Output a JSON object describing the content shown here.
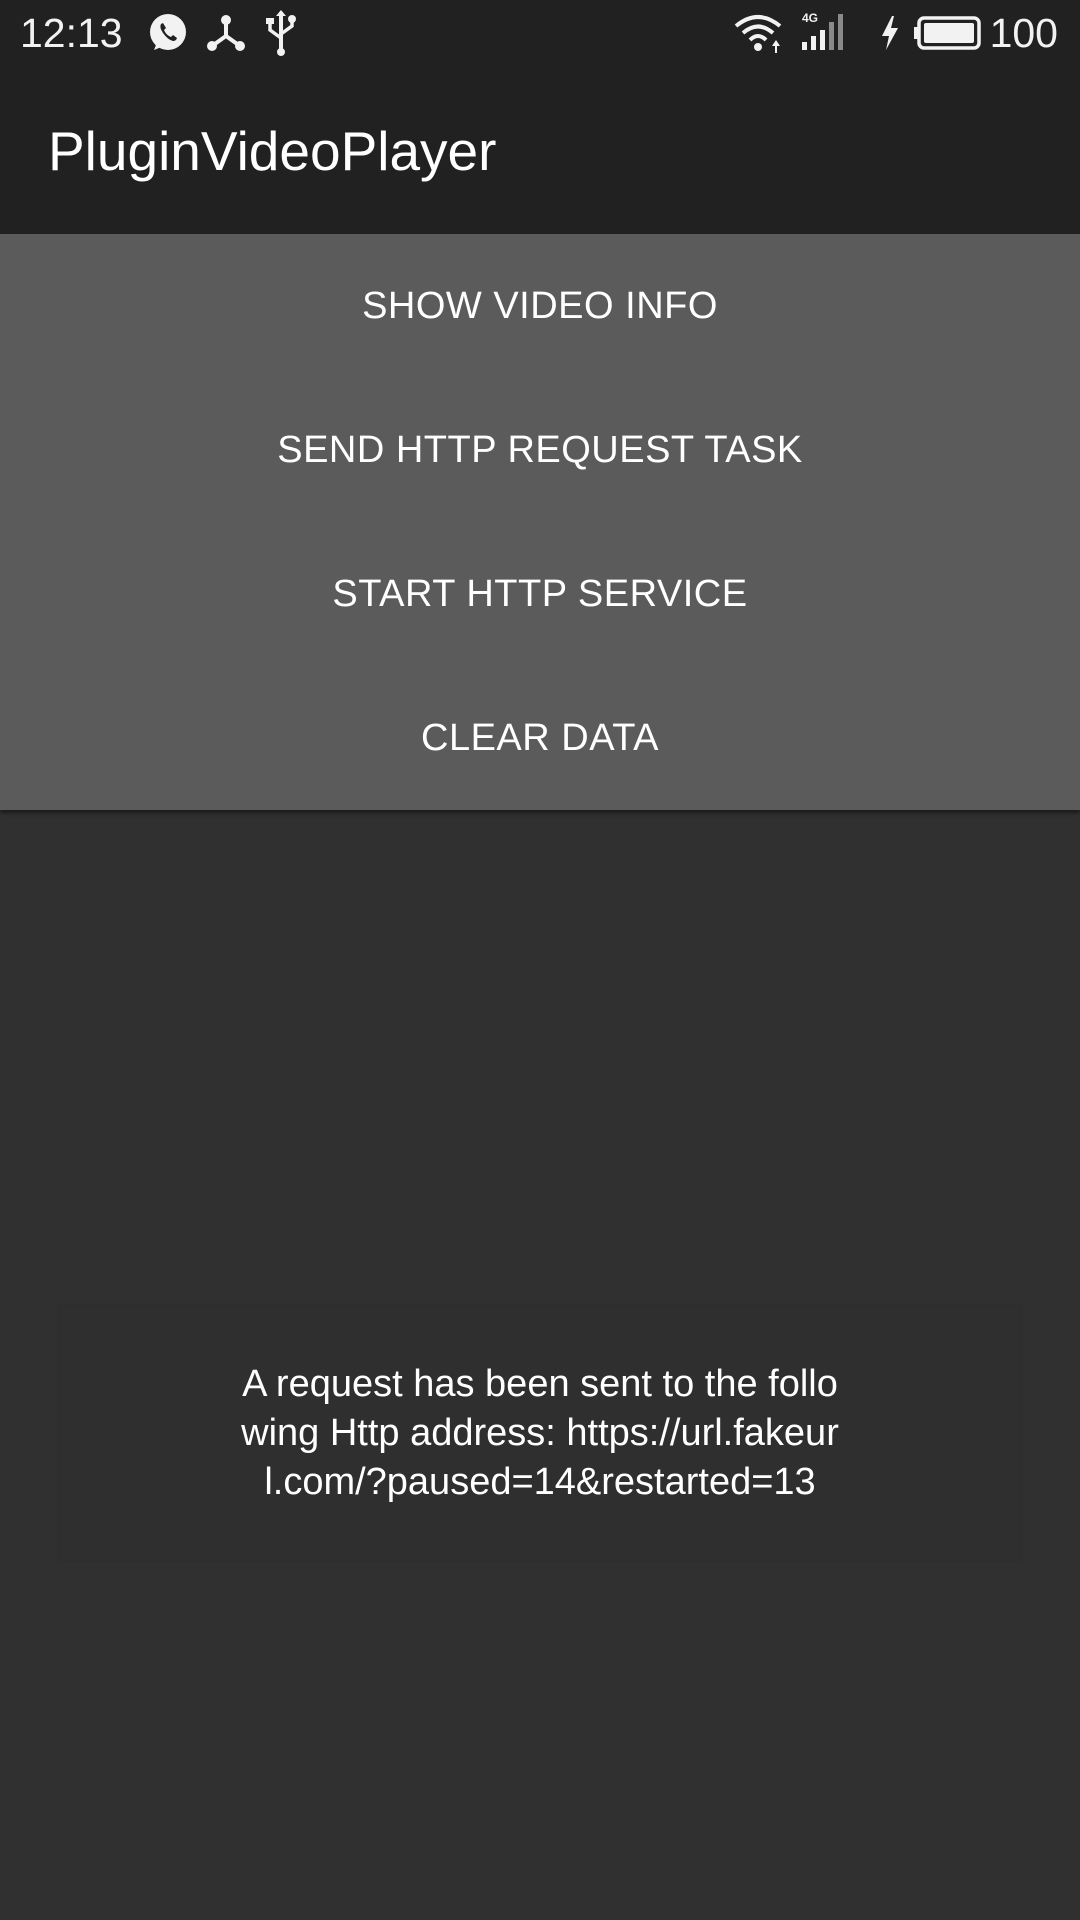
{
  "status_bar": {
    "time": "12:13",
    "battery_percent": "100",
    "icons": [
      "whatsapp-icon",
      "share-hub-icon",
      "usb-icon",
      "wifi-icon",
      "signal-4g-icon",
      "charging-bolt-icon",
      "battery-icon"
    ],
    "network_label": "4G"
  },
  "app_bar": {
    "title": "PluginVideoPlayer"
  },
  "buttons": [
    {
      "label": "SHOW VIDEO INFO"
    },
    {
      "label": "SEND HTTP REQUEST TASK"
    },
    {
      "label": "START HTTP SERVICE"
    },
    {
      "label": "CLEAR DATA"
    }
  ],
  "message": {
    "text": "A request has been sent to the following Http address: https://url.fakeurl.com/?paused=14&restarted=13"
  },
  "colors": {
    "status_bar_bg": "#212121",
    "button_panel_bg": "#5b5b5b",
    "screen_bg": "#303030",
    "text": "#ffffff"
  }
}
